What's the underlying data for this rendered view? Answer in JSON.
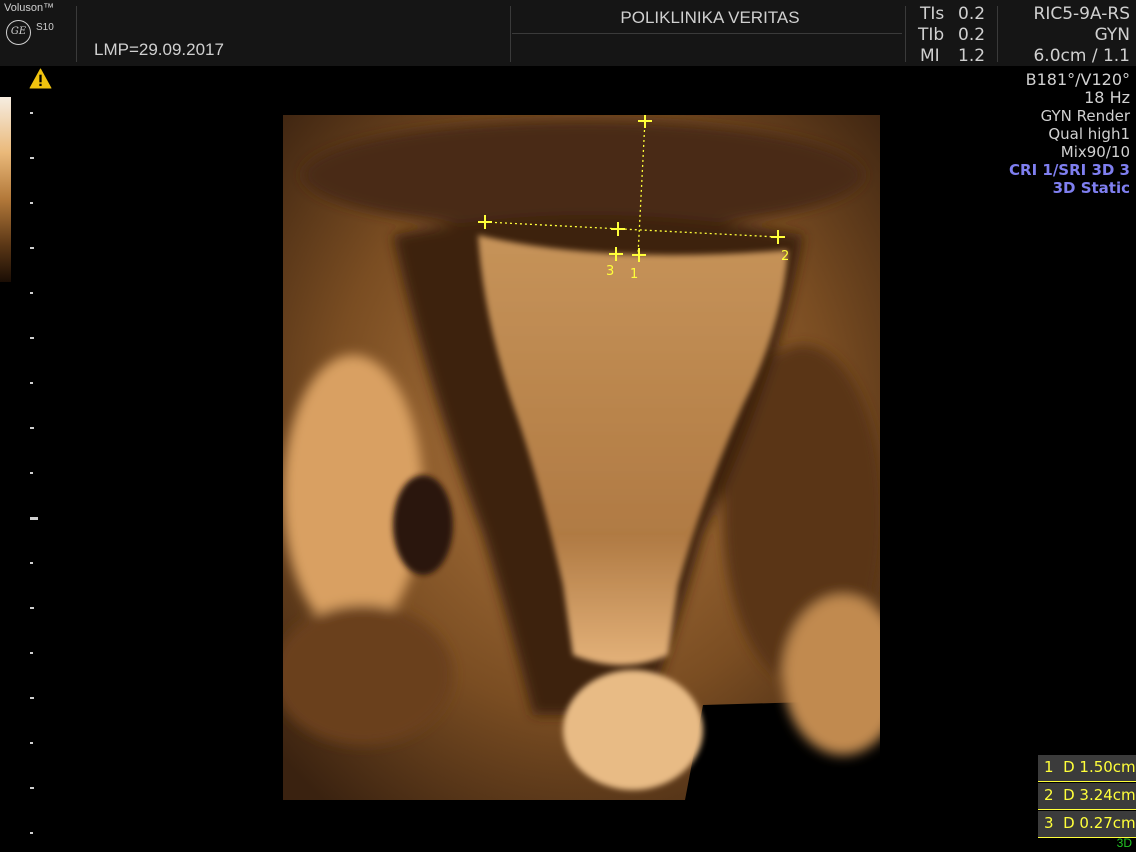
{
  "header": {
    "brand": "Voluson™",
    "logo": "GE",
    "model": "S10",
    "lmp": "LMP=29.09.2017",
    "clinic": "POLIKLINIKA VERITAS",
    "indices": [
      {
        "label": "TIs",
        "value": "0.2"
      },
      {
        "label": "TIb",
        "value": "0.2"
      },
      {
        "label": "MI",
        "value": "1.2"
      }
    ],
    "probe": [
      "RIC5-9A-RS",
      "GYN",
      "6.0cm / 1.1"
    ]
  },
  "params": {
    "lines": [
      "B181°/V120°",
      "18 Hz",
      "GYN Render",
      "Qual high1",
      "Mix90/10"
    ],
    "blue_lines": [
      "CRI 1/SRI 3D 3",
      "3D Static"
    ]
  },
  "markers": [
    "1",
    "2",
    "3"
  ],
  "measurements": [
    {
      "num": "1",
      "text": "D 1.50cm"
    },
    {
      "num": "2",
      "text": "D 3.24cm"
    },
    {
      "num": "3",
      "text": "D 0.27cm"
    }
  ],
  "mode": "3D",
  "colors": {
    "caliper": "#ffff3a",
    "accent_blue": "#7f7ff0",
    "mode_green": "#23c323",
    "render_tone": "#c98a4a"
  },
  "icons": {
    "warning": "warning-icon",
    "logo": "ge-logo-icon"
  }
}
